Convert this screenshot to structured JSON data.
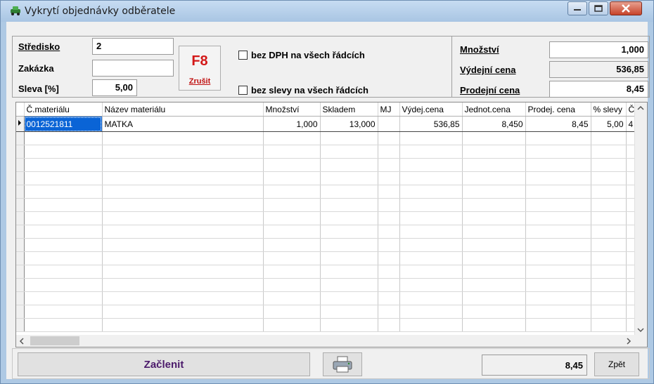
{
  "window": {
    "title": "Vykrytí objednávky odběratele"
  },
  "header": {
    "stredisko_label": "Středisko",
    "stredisko_value": "2",
    "zakazka_label": "Zakázka",
    "zakazka_value": "",
    "sleva_label": "Sleva [%]",
    "sleva_value": "5,00",
    "f8_label": "F8",
    "zrusit_label": "Zrušit",
    "bez_dph_label": "bez DPH na všech řádcích",
    "bez_slevy_label": "bez slevy na všech řádcích",
    "mnozstvi_label": "Množství",
    "mnozstvi_value": "1,000",
    "vydejni_label": "Výdejní cena",
    "vydejni_value": "536,85",
    "prodejni_label": "Prodejní cena",
    "prodejni_value": "8,45"
  },
  "grid": {
    "columns": [
      "Č.materiálu",
      "Název materiálu",
      "Množství",
      "Skladem",
      "MJ",
      "Výdej.cena",
      "Jednot.cena",
      "Prodej. cena",
      "% slevy",
      "Č"
    ],
    "rows": [
      [
        "0012521811",
        "MATKA",
        "1,000",
        "13,000",
        "",
        "536,85",
        "8,450",
        "8,45",
        "5,00",
        "4"
      ]
    ]
  },
  "footer": {
    "zaclenit_label": "Začlenit",
    "total_value": "8,45",
    "zpet_label": "Zpět"
  },
  "icons": {
    "app": "car-icon",
    "print": "printer-icon"
  }
}
